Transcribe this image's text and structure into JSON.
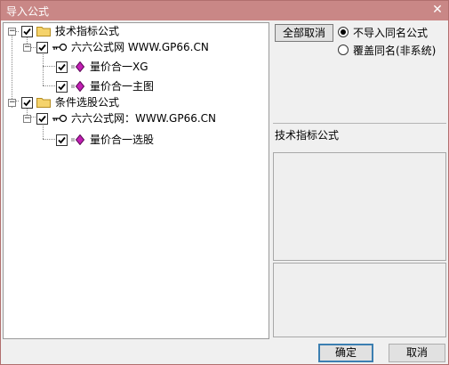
{
  "window": {
    "title": "导入公式",
    "close_glyph": "✕"
  },
  "tree": [
    {
      "label": "技术指标公式",
      "icon": "folder-icon",
      "checked": true,
      "expanded": true
    },
    {
      "label": "六六公式网 WWW.GP66.CN",
      "icon": "key-icon",
      "checked": true,
      "expanded": true
    },
    {
      "label": "量价合一XG",
      "icon": "formula-diamond-icon",
      "checked": true
    },
    {
      "label": "量价合一主图",
      "icon": "formula-diamond-icon",
      "checked": true
    },
    {
      "label": "条件选股公式",
      "icon": "folder-icon",
      "checked": true,
      "expanded": true
    },
    {
      "label": "六六公式网：WWW.GP66.CN",
      "icon": "key-icon",
      "checked": true,
      "expanded": true
    },
    {
      "label": "量价合一选股",
      "icon": "formula-diamond-icon",
      "checked": true
    }
  ],
  "side": {
    "cancel_all_label": "全部取消",
    "option_no_import": "不导入同名公式",
    "option_overwrite": "覆盖同名(非系统)",
    "selected_option": "不导入同名公式",
    "description_title": "技术指标公式"
  },
  "footer": {
    "ok_label": "确定",
    "cancel_label": "取消"
  },
  "colors": {
    "titlebar": "#c98786",
    "folder": "#f5d36b",
    "diamond": "#c21fb4"
  }
}
